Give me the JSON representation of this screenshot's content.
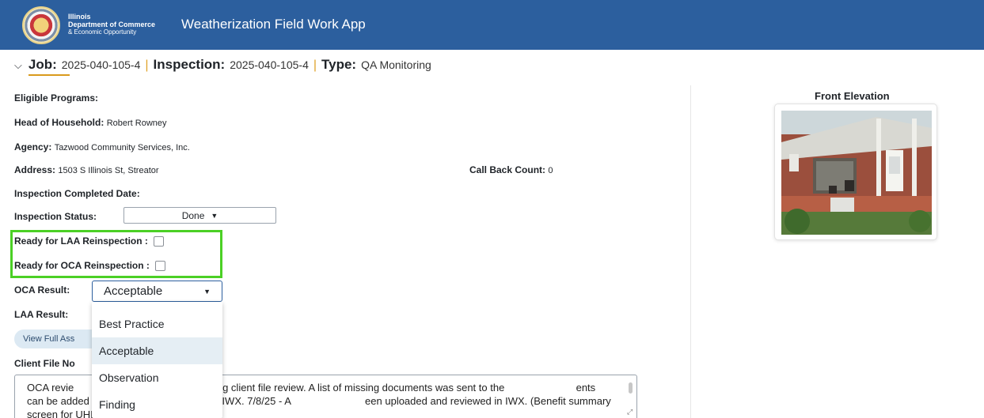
{
  "header": {
    "logo_line1": "Illinois",
    "logo_line2": "Department of Commerce",
    "logo_line3": "& Economic Opportunity",
    "app_title": "Weatherization Field Work App",
    "colors": {
      "bar": "#2c5f9e",
      "accent": "#d99a1c"
    }
  },
  "job": {
    "job_label": "Job:",
    "job_value": "2025-040-105-4",
    "inspection_label": "Inspection:",
    "inspection_value": "2025-040-105-4",
    "type_label": "Type:",
    "type_value": "QA Monitoring"
  },
  "details": {
    "eligible_label": "Eligible Programs:",
    "head_label": "Head of Household:",
    "head_value": "Robert Rowney",
    "agency_label": "Agency:",
    "agency_value": "Tazwood Community Services, Inc.",
    "address_label": "Address:",
    "address_value": "1503 S Illinois St, Streator",
    "callback_label": "Call Back Count:",
    "callback_value": "0",
    "completed_label": "Inspection Completed Date:",
    "status_label": "Inspection Status:",
    "status_value": "Done",
    "laa_reinspect_label": "Ready for LAA Reinspection :",
    "oca_reinspect_label": "Ready for OCA Reinspection :",
    "oca_result_label": "OCA Result:",
    "oca_result_value": "Acceptable",
    "laa_result_label": "LAA Result:",
    "view_button": "View Full Ass",
    "client_file_label": "Client File No",
    "notes_text": "OCA revie                       ents missing during client file review. A list of missing documents was sent to the                         ents can be added to the respective sections in IWX. 7/8/25 - A                          een uploaded and reviewed in IWX. (Benefit summary screen for UHEAP"
  },
  "dropdown": {
    "options": [
      "Best Practice",
      "Acceptable",
      "Observation",
      "Finding"
    ],
    "selected": "Acceptable"
  },
  "front_elevation": {
    "title": "Front Elevation"
  }
}
